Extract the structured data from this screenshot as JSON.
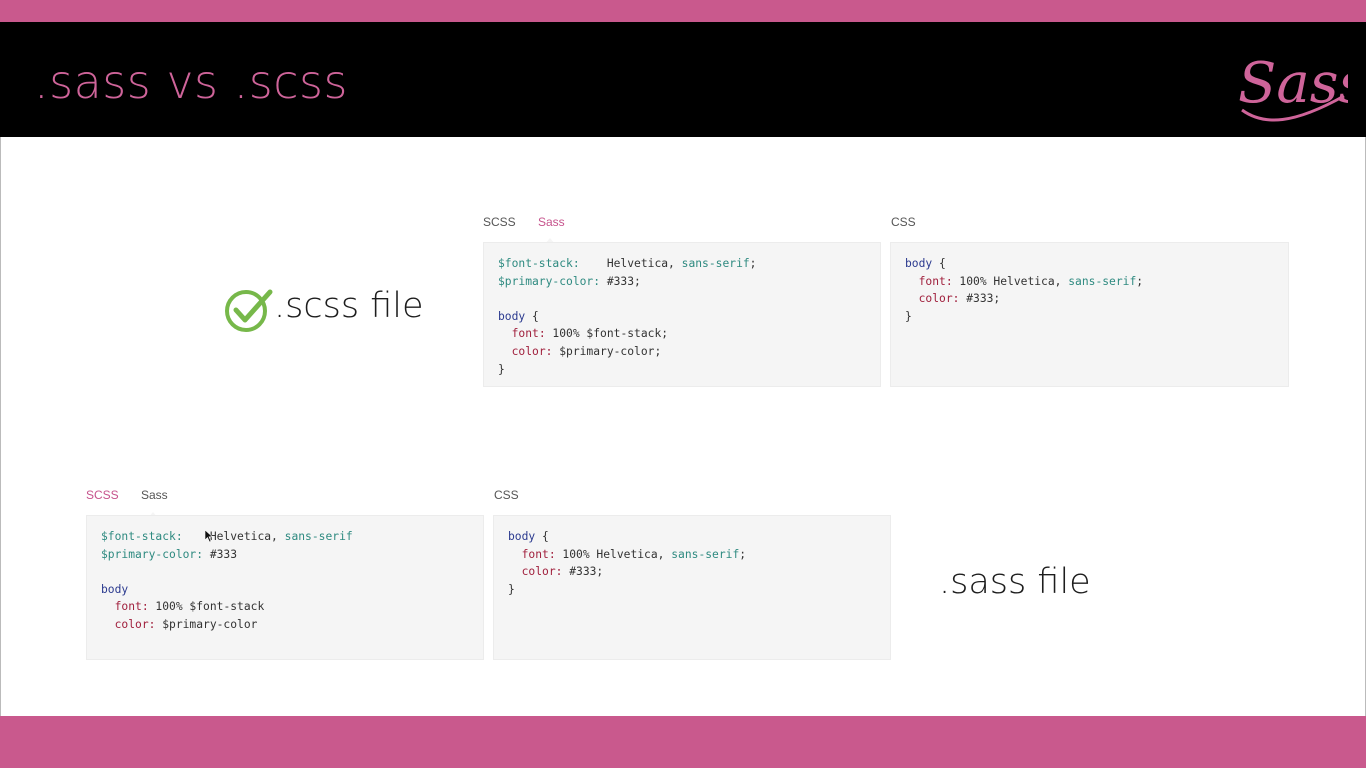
{
  "slide": {
    "title": ".sass vs .scss",
    "logo_text": "Sass",
    "colors": {
      "brand_pink": "#c9598d",
      "header_bg": "#000000",
      "code_bg": "#f5f5f5",
      "check_green": "#77b84a"
    }
  },
  "scss_section": {
    "label": ".scss file",
    "icon": "check-circle-icon",
    "tabs": {
      "scss": "SCSS",
      "sass": "Sass",
      "css": "CSS",
      "active": "Sass"
    },
    "source": {
      "line1_var": "$font-stack:",
      "line1_val": "    Helvetica, ",
      "line1_kw": "sans-serif",
      "line1_end": ";",
      "line2_var": "$primary-color:",
      "line2_val": " #333;",
      "line4_sel": "body",
      "line4_brace": " {",
      "line5_prop": "font:",
      "line5_val": " 100% $font-stack;",
      "line6_prop": "color:",
      "line6_val": " $primary-color;",
      "line7": "}"
    },
    "output": {
      "line1_sel": "body",
      "line1_brace": " {",
      "line2_prop": "font:",
      "line2_val": " 100% Helvetica, ",
      "line2_kw": "sans-serif",
      "line2_end": ";",
      "line3_prop": "color:",
      "line3_val": " #333;",
      "line4": "}"
    }
  },
  "sass_section": {
    "label": ".sass file",
    "tabs": {
      "scss": "SCSS",
      "sass": "Sass",
      "css": "CSS",
      "active": "SCSS"
    },
    "source": {
      "line1_var": "$font-stack:",
      "line1_val": "    Helvetica, ",
      "line1_kw": "sans-serif",
      "line2_var": "$primary-color:",
      "line2_val": " #333",
      "line4_sel": "body",
      "line5_prop": "font:",
      "line5_val": " 100% $font-stack",
      "line6_prop": "color:",
      "line6_val": " $primary-color"
    },
    "output": {
      "line1_sel": "body",
      "line1_brace": " {",
      "line2_prop": "font:",
      "line2_val": " 100% Helvetica, ",
      "line2_kw": "sans-serif",
      "line2_end": ";",
      "line3_prop": "color:",
      "line3_val": " #333;",
      "line4": "}"
    }
  }
}
